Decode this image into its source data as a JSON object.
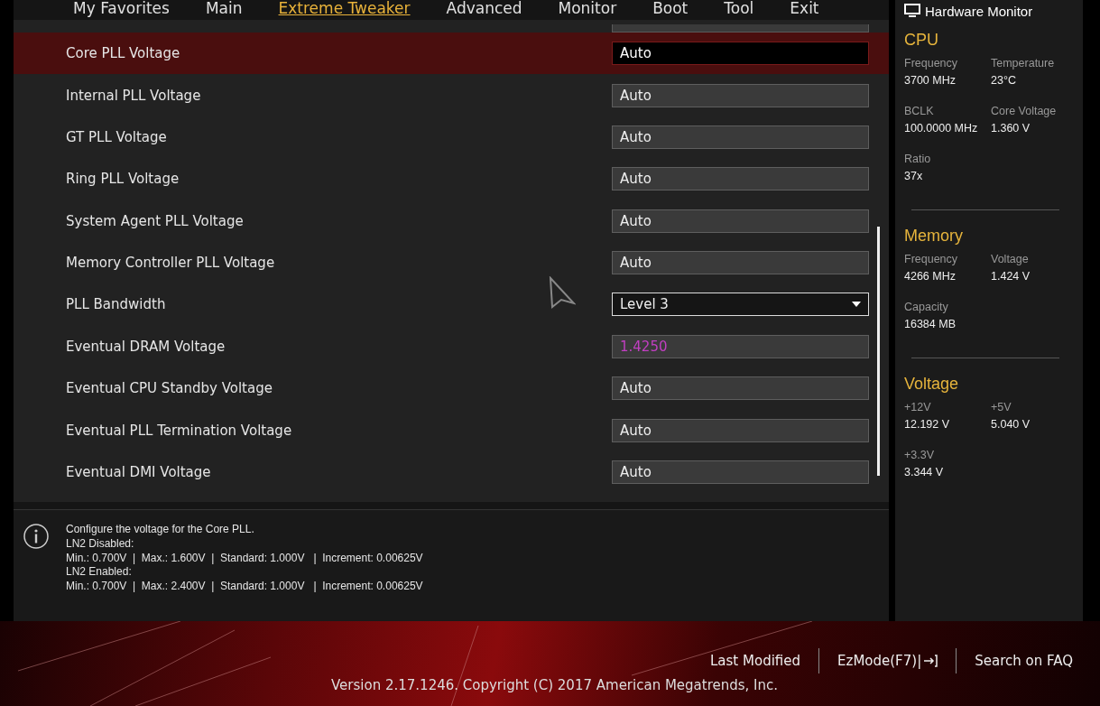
{
  "menu": [
    {
      "label": "My Favorites",
      "selected": false
    },
    {
      "label": "Main",
      "selected": false
    },
    {
      "label": "Extreme Tweaker",
      "selected": true
    },
    {
      "label": "Advanced",
      "selected": false
    },
    {
      "label": "Monitor",
      "selected": false
    },
    {
      "label": "Boot",
      "selected": false
    },
    {
      "label": "Tool",
      "selected": false
    },
    {
      "label": "Exit",
      "selected": false
    }
  ],
  "settings": [
    {
      "label": "Core PLL Voltage",
      "value": "Auto",
      "kind": "field",
      "selected": true,
      "color": "#ffffff"
    },
    {
      "label": "Internal PLL Voltage",
      "value": "Auto",
      "kind": "field",
      "selected": false,
      "color": "#eeeeee"
    },
    {
      "label": "GT PLL Voltage",
      "value": "Auto",
      "kind": "field",
      "selected": false,
      "color": "#eeeeee"
    },
    {
      "label": "Ring PLL Voltage",
      "value": "Auto",
      "kind": "field",
      "selected": false,
      "color": "#eeeeee"
    },
    {
      "label": "System Agent PLL Voltage",
      "value": "Auto",
      "kind": "field",
      "selected": false,
      "color": "#eeeeee"
    },
    {
      "label": "Memory Controller PLL Voltage",
      "value": "Auto",
      "kind": "field",
      "selected": false,
      "color": "#eeeeee"
    },
    {
      "label": "PLL Bandwidth",
      "value": "Level 3",
      "kind": "dropdown",
      "selected": false
    },
    {
      "label": "Eventual DRAM Voltage",
      "value": "1.4250",
      "kind": "field",
      "selected": false,
      "color": "#c23fc2"
    },
    {
      "label": "Eventual CPU Standby Voltage",
      "value": "Auto",
      "kind": "field",
      "selected": false,
      "color": "#eeeeee"
    },
    {
      "label": "Eventual PLL Termination Voltage",
      "value": "Auto",
      "kind": "field",
      "selected": false,
      "color": "#eeeeee"
    },
    {
      "label": "Eventual DMI Voltage",
      "value": "Auto",
      "kind": "field",
      "selected": false,
      "color": "#eeeeee"
    }
  ],
  "help": {
    "lines": [
      "Configure the voltage for the Core PLL.",
      "LN2 Disabled:",
      "Min.: 0.700V  |  Max.: 1.600V  |  Standard: 1.000V   |  Increment: 0.00625V",
      "LN2 Enabled:",
      "Min.: 0.700V  |  Max.: 2.400V  |  Standard: 1.000V   |  Increment: 0.00625V"
    ]
  },
  "hardware_monitor": {
    "title": "Hardware Monitor",
    "sections": [
      {
        "title": "CPU",
        "items": [
          {
            "label": "Frequency",
            "value": "3700 MHz"
          },
          {
            "label": "Temperature",
            "value": "23°C"
          },
          {
            "label": "BCLK",
            "value": "100.0000 MHz"
          },
          {
            "label": "Core Voltage",
            "value": "1.360 V"
          },
          {
            "label": "Ratio",
            "value": "37x"
          }
        ]
      },
      {
        "title": "Memory",
        "items": [
          {
            "label": "Frequency",
            "value": "4266 MHz"
          },
          {
            "label": "Voltage",
            "value": "1.424 V"
          },
          {
            "label": "Capacity",
            "value": "16384 MB"
          }
        ]
      },
      {
        "title": "Voltage",
        "items": [
          {
            "label": "+12V",
            "value": "12.192 V"
          },
          {
            "label": "+5V",
            "value": "5.040 V"
          },
          {
            "label": "+3.3V",
            "value": "3.344 V"
          }
        ]
      }
    ]
  },
  "footer": {
    "links": [
      "Last Modified",
      "EzMode(F7)|",
      "Search on FAQ"
    ],
    "version": "Version 2.17.1246. Copyright (C) 2017 American Megatrends, Inc."
  }
}
